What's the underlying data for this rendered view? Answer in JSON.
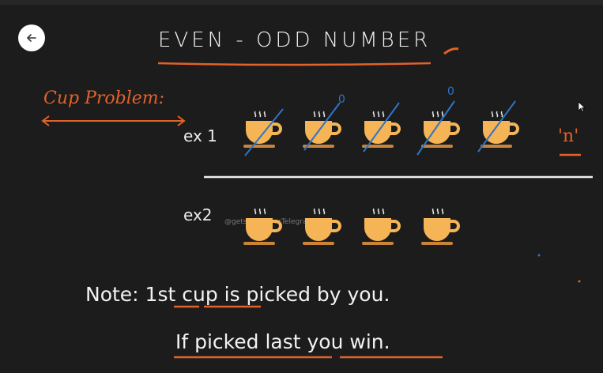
{
  "title": "EVEN - ODD  NUMBER",
  "cup_problem": "Cup Problem:",
  "ex1_label": "ex 1",
  "ex2_label": "ex2",
  "n_label": "'n'",
  "note_line": "Note:  1st cup is picked by you.",
  "win_line": "If picked last  you win.",
  "watermark": "@getstudyfeverTelegram",
  "marker_zero": "0",
  "icons": {
    "back": "arrow-left-icon",
    "cup": "coffee-cup-icon",
    "cursor": "mouse-pointer-icon"
  },
  "colors": {
    "background": "#1c1c1c",
    "ink": "#f2f2f2",
    "orange": "#e0622a",
    "blue": "#2f74c7",
    "cup": "#f5b455"
  },
  "ex1_cups_crossed": 5,
  "ex2_cups": 4
}
